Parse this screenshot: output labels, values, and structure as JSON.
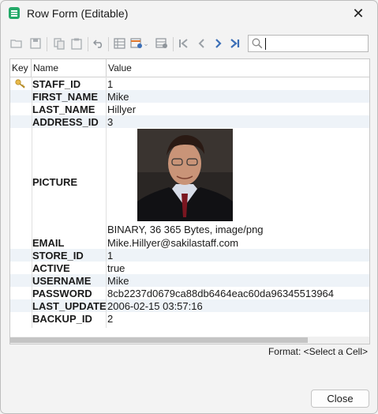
{
  "window": {
    "title": "Row Form (Editable)"
  },
  "toolbar": {
    "buttons": [
      "folder-open-icon",
      "save-icon",
      "copy-icon",
      "paste-icon",
      "undo-icon",
      "grid-view-icon",
      "grid-settings-icon",
      "dropdown-arrow-icon",
      "export-icon",
      "first-record-icon",
      "previous-record-icon",
      "next-record-icon",
      "last-record-icon"
    ],
    "search_value": ""
  },
  "grid": {
    "headers": {
      "key": "Key",
      "name": "Name",
      "value": "Value"
    },
    "rows": [
      {
        "name": "STAFF_ID",
        "value": "1",
        "key": true
      },
      {
        "name": "FIRST_NAME",
        "value": "Mike"
      },
      {
        "name": "LAST_NAME",
        "value": "Hillyer"
      },
      {
        "name": "ADDRESS_ID",
        "value": "3"
      },
      {
        "name": "PICTURE",
        "value": "BINARY, 36 365 Bytes, image/png"
      },
      {
        "name": "EMAIL",
        "value": "Mike.Hillyer@sakilastaff.com"
      },
      {
        "name": "STORE_ID",
        "value": "1"
      },
      {
        "name": "ACTIVE",
        "value": "true"
      },
      {
        "name": "USERNAME",
        "value": "Mike"
      },
      {
        "name": "PASSWORD",
        "value": "8cb2237d0679ca88db6464eac60da96345513964"
      },
      {
        "name": "LAST_UPDATE",
        "value": "2006-02-15 03:57:16"
      },
      {
        "name": "BACKUP_ID",
        "value": "2"
      }
    ]
  },
  "status": {
    "format": "Format: <Select a Cell>"
  },
  "footer": {
    "close_label": "Close"
  },
  "colors": {
    "accent": "#3c6fb7",
    "row_alt": "#eef3f8",
    "app_icon": "#24a968"
  }
}
